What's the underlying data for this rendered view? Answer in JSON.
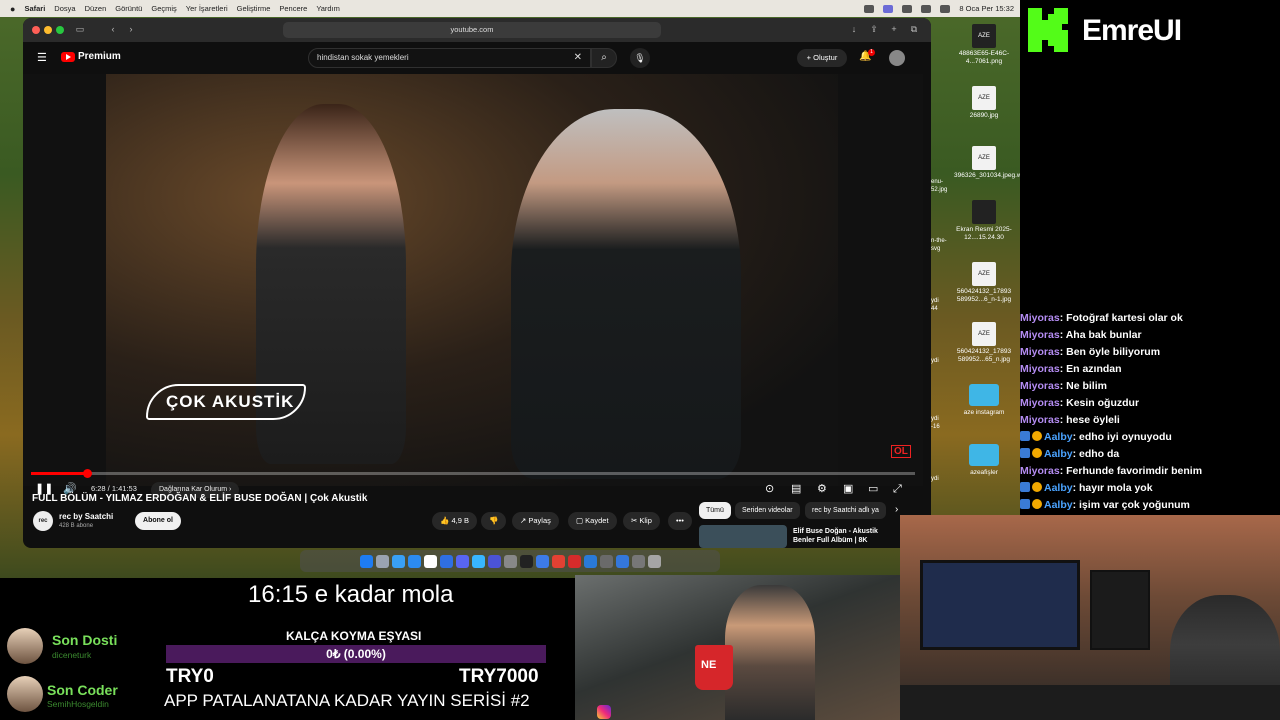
{
  "menubar": {
    "app": "Safari",
    "items": [
      "Dosya",
      "Düzen",
      "Görüntü",
      "Geçmiş",
      "Yer İşaretleri",
      "Geliştirme",
      "Pencere",
      "Yardım"
    ],
    "datetime": "8 Oca Per  15:32"
  },
  "safari": {
    "url": "youtube.com"
  },
  "youtube": {
    "logo_text": "Premium",
    "search_value": "hindistan sokak yemekleri",
    "create_label": "Oluştur",
    "notification_count": "1",
    "player": {
      "watermark": "ÇOK AKUSTİK",
      "corner_badge": "OL",
      "time": "6:28 / 1:41:53",
      "chapter": "Dağlarına Kar Olurum",
      "progress": 0.063
    },
    "video_title": "FULL BÖLÜM - YILMAZ ERDOĞAN & ELİF BUSE DOĞAN | Çok Akustik",
    "channel": {
      "avatar_text": "rec",
      "name": "rec by Saatchi",
      "subs": "428 B abone",
      "subscribe_label": "Abone ol"
    },
    "actions": {
      "likes": "4,9 B",
      "share": "Paylaş",
      "save": "Kaydet",
      "clip": "Klip",
      "more": "•••"
    },
    "chips": [
      "Tümü",
      "Seriden videolar",
      "rec by Saatchi adlı ya"
    ],
    "recommended_title": "Elif Buse Doğan - Akustik Benler Full Albüm | 8K"
  },
  "desktop_files": [
    {
      "name": "48863E65-E46C-4...7061.png",
      "thumb": "AZE"
    },
    {
      "name": "26890.jpg",
      "thumb": "AZE"
    },
    {
      "name": "396326_301034.jpeg.webp",
      "thumb": "AZE"
    },
    {
      "name": "Ekran Resmi 2025-12....15.24.30",
      "thumb": ""
    },
    {
      "name": "560424132_17893 589952...6_n-1.jpg",
      "thumb": "AZE"
    },
    {
      "name": "560424132_17893 589952...65_n.jpg",
      "thumb": "AZE"
    },
    {
      "name": "aze instagram",
      "thumb": ""
    },
    {
      "name": "azeafişler",
      "thumb": ""
    }
  ],
  "edge_labels": [
    "enu-",
    "52.jpg",
    "n-the-",
    "svg",
    "ydi",
    "44",
    "ydi",
    "ydi",
    "-16",
    "ydi",
    "ydi",
    "ydi",
    "ydi"
  ],
  "brand": {
    "name": "EmreUI",
    "color": "#53fc18"
  },
  "chat": [
    {
      "user": "Miyoras",
      "text": "Fotoğraf kartesi olar ok",
      "badges": false
    },
    {
      "user": "Miyoras",
      "text": "Aha bak bunlar",
      "badges": false
    },
    {
      "user": "Miyoras",
      "text": "Ben öyle biliyorum",
      "badges": false
    },
    {
      "user": "Miyoras",
      "text": "En azından",
      "badges": false
    },
    {
      "user": "Miyoras",
      "text": "Ne bilim",
      "badges": false
    },
    {
      "user": "Miyoras",
      "text": "Kesin oğuzdur",
      "badges": false
    },
    {
      "user": "Miyoras",
      "text": "hese öyleli",
      "badges": false
    },
    {
      "user": "Aalby",
      "text": "edho iyi oynuyodu",
      "badges": true
    },
    {
      "user": "Aalby",
      "text": "edho da",
      "badges": true
    },
    {
      "user": "Miyoras",
      "text": "Ferhunde favorimdir benim",
      "badges": false
    },
    {
      "user": "Aalby",
      "text": "hayır mola yok",
      "badges": true
    },
    {
      "user": "Aalby",
      "text": "işim var çok yoğunum",
      "badges": true
    }
  ],
  "overlay": {
    "break_text": "16:15 e kadar mola",
    "friends": [
      {
        "role": "Son Dosti",
        "name": "diceneturk"
      },
      {
        "role": "Son Coder",
        "name": "SemihHosgeldin"
      }
    ],
    "goal": {
      "label": "KALÇA KOYMA EŞYASI",
      "text": "0₺ (0.00%)",
      "progress": 0.0,
      "min": "TRY0",
      "max": "TRY7000"
    },
    "series": "APP PATALANATANA KADAR YAYIN SERİSİ #2"
  },
  "cam": {
    "cup_text": "NE"
  }
}
